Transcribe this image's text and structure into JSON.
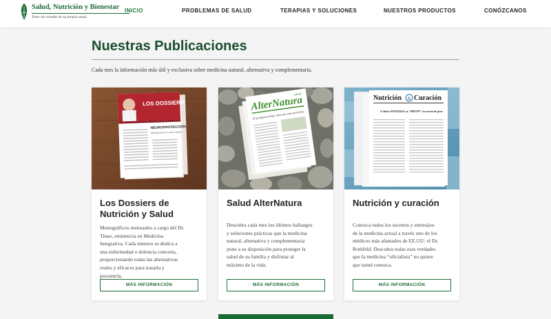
{
  "brand": {
    "title": "Salud, Nutrición y Bienestar",
    "tagline": "Tome las riendas de su propia salud."
  },
  "nav": {
    "items": [
      {
        "label": "INICIO",
        "active": true
      },
      {
        "label": "PROBLEMAS DE SALUD",
        "active": false
      },
      {
        "label": "TERAPIAS Y SOLUCIONES",
        "active": false
      },
      {
        "label": "NUESTROS PRODUCTOS",
        "active": false
      },
      {
        "label": "CONÓZCANOS",
        "active": false
      }
    ]
  },
  "section": {
    "title": "Nuestras Publicaciones",
    "subtitle": "Cada mes la información más útil y exclusiva sobre medicina natural, alternativa y complementaria."
  },
  "cards": [
    {
      "title_lines": [
        "Los Dossiers de",
        "Nutrición y Salud"
      ],
      "desc_lines": [
        "Monográficos mensuales a cargo del Dr.",
        "Tinao, eminencia en Medicina",
        "Integrativa. Cada número se dedica a",
        "una enfermedad o dolencia concreta,",
        "proporcionando todas las alternativas",
        "reales y eficaces para tratarla y",
        "prevenirla."
      ],
      "button": "MÁS INFORMACIÓN",
      "cover": {
        "masthead": "LOS DOSSIERS",
        "headline": "NEUROPROTECCIÓN",
        "subhead": "Salvaguarda de su salud cognitiva"
      }
    },
    {
      "title_lines": [
        "Salud AlterNatura"
      ],
      "desc_lines": [
        "Descubra cada mes los últimos hallazgos",
        "y soluciones prácticas que la medicina",
        "natural, alternativa y complementaria",
        "pone a su disposición para proteger la",
        "salud de su familia y disfrutar al",
        "máximo de la vida."
      ],
      "button": "MÁS INFORMACIÓN",
      "cover": {
        "masthead": "AlterNatura",
        "label": "salud",
        "headline": "El prodigioso hongo chino que sana las heridas"
      }
    },
    {
      "title_lines": [
        "Nutrición y curación"
      ],
      "desc_lines": [
        "Conozca todos los secretos y entresijos",
        "de la medicina actual a través uno de los",
        "médicos más afamados de EE.UU: el Dr.",
        "Rothfeld. Descubra todas esas verdades",
        "que la medicina “oficialista” no quiere",
        "que usted conozca."
      ],
      "button": "MÁS INFORMACIÓN",
      "cover": {
        "masthead_left": "Nutrición",
        "masthead_amp": "&",
        "masthead_right": "Curación",
        "headline": "Y ahora ANTIGRAS ya \"DRVEN\" en exceso de peso"
      }
    }
  ],
  "colors": {
    "brand_green": "#1d6b34",
    "heading_green": "#1a4d2e",
    "active_nav": "#1d7a3c",
    "page_bg": "#f4f4f4"
  }
}
